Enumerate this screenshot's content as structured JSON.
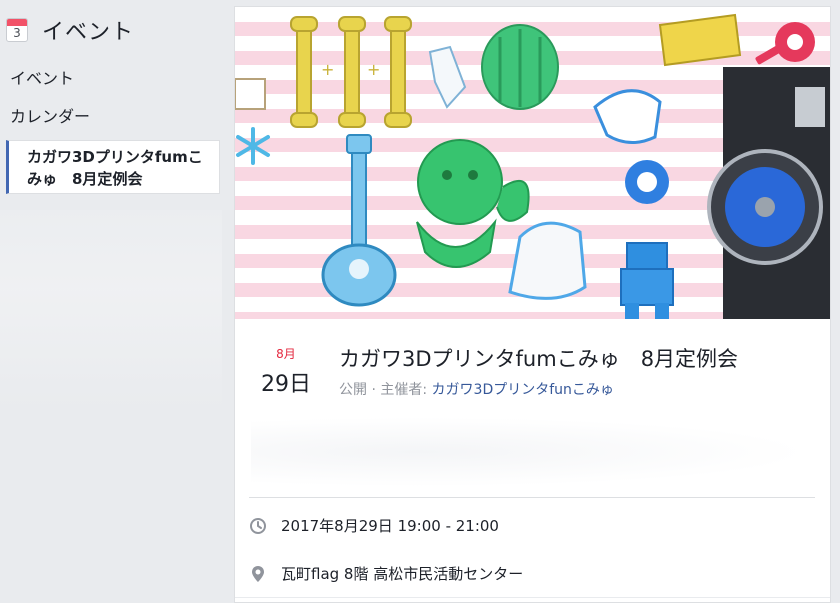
{
  "sidebar": {
    "calendar_icon_day": "3",
    "title": "イベント",
    "items": [
      {
        "label": "イベント"
      },
      {
        "label": "カレンダー"
      },
      {
        "label": "カガワ3Dプリンタfumこみゅ　8月定例会"
      }
    ]
  },
  "event": {
    "cover_alt_icons": [
      "bone-toy-icon",
      "cage-toy-icon",
      "guitar-toy-icon",
      "character-toy-icon",
      "robot-toy-icon",
      "heart-key-icon",
      "snowflake-icon",
      "3d-printer-icon"
    ],
    "date": {
      "month": "8月",
      "day": "29日"
    },
    "title": "カガワ3Dプリンタfumこみゅ　8月定例会",
    "visibility": "公開",
    "separator": "·",
    "organizer_prefix": "主催者:",
    "organizer": "カガワ3Dプリンタfunこみゅ",
    "time": "2017年8月29日 19:00 - 21:00",
    "place": "瓦町flag 8階 高松市民活動センター"
  },
  "colors": {
    "accent": "#4267b2",
    "month_red": "#e4283f",
    "link": "#365899",
    "muted": "#90949c",
    "background": "#e9ebee"
  }
}
